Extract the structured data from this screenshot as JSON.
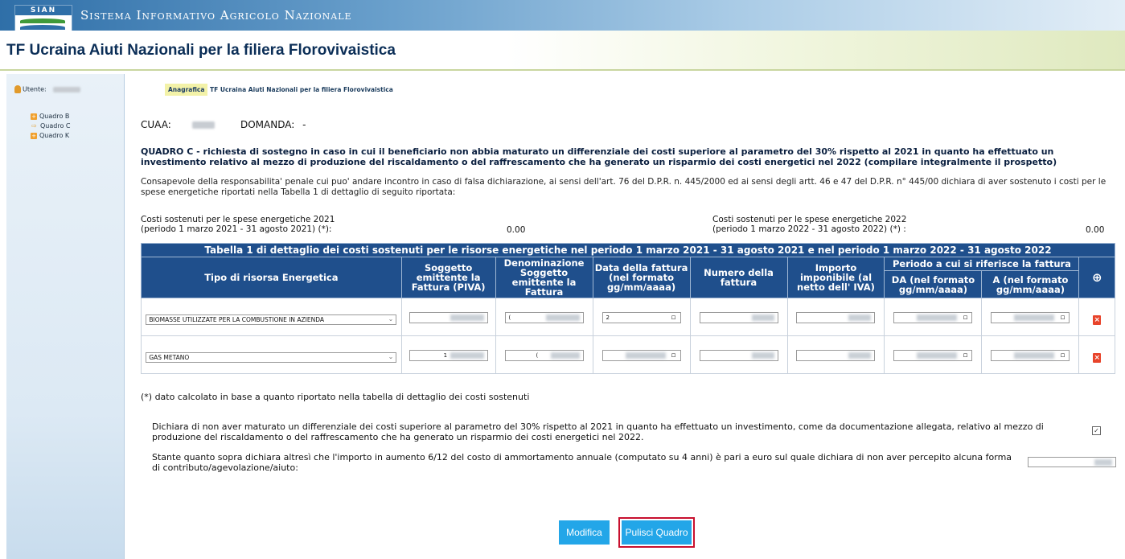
{
  "header": {
    "logo_text": "SIAN",
    "system_title": "Sistema Informativo Agricolo Nazionale",
    "app_title": "TF Ucraina Aiuti Nazionali per la filiera Florovivaistica"
  },
  "sidebar": {
    "user_label": "Utente:",
    "items": [
      {
        "label": "Quadro B",
        "icon": "orange-plus-icon"
      },
      {
        "label": "Quadro C",
        "icon": "arrow-icon"
      },
      {
        "label": "Quadro K",
        "icon": "orange-plus-icon"
      }
    ]
  },
  "breadcrumb": {
    "first": "Anagrafica",
    "second": "TF Ucraina Aiuti Nazionali per la filiera Florovivaistica"
  },
  "cuaa_label": "CUAA:",
  "domanda_label": "DOMANDA:",
  "domanda_value": "-",
  "quadro": {
    "title_bold": "QUADRO C",
    "title_rest": " - richiesta di sostegno in caso in cui il beneficiario non abbia maturato un differenziale dei costi superiore al parametro del 30% rispetto al 2021 in quanto ha effettuato un investimento relativo al mezzo di produzione del riscaldamento o del raffrescamento che ha generato un risparmio dei costi energetici nel 2022 (compilare integralmente il prospetto)",
    "consapevole": "Consapevole della responsabilita' penale cui puo' andare incontro in caso di falsa dichiarazione, ai sensi dell'art. 76 del D.P.R. n. 445/2000 ed ai sensi degli artt. 46 e 47 del D.P.R. n° 445/00 dichiara di aver sostenuto i costi per le spese energetiche riportati nella Tabella 1 di dettaglio di seguito riportata:"
  },
  "costi": {
    "left_line1": "Costi sostenuti per le spese energetiche 2021",
    "left_line2": "(periodo 1 marzo 2021 - 31 agosto 2021) (*):",
    "left_value": "0.00",
    "right_line1": "Costi sostenuti per le spese energetiche 2022",
    "right_line2": "(periodo 1 marzo 2022 - 31 agosto 2022) (*) :",
    "right_value": "0.00"
  },
  "table": {
    "caption": "Tabella 1 di dettaglio dei costi sostenuti per le risorse energetiche nel periodo 1 marzo 2021 - 31 agosto 2021 e nel periodo 1 marzo 2022 - 31 agosto 2022",
    "headers": {
      "tipo": "Tipo di risorsa Energetica",
      "soggetto": "Soggetto emittente la Fattura (PIVA)",
      "denominazione": "Denominazione Soggetto emittente la Fattura",
      "data": "Data della fattura (nel formato gg/mm/aaaa)",
      "numero": "Numero della fattura",
      "importo": "Importo imponibile (al netto dell' IVA)",
      "periodo": "Periodo a cui si riferisce la fattura",
      "da": "DA (nel formato gg/mm/aaaa)",
      "a": "A (nel formato gg/mm/aaaa)",
      "add_icon": "⊕"
    },
    "rows": [
      {
        "tipo": "BIOMASSE UTILIZZATE PER LA COMBUSTIONE IN AZIENDA",
        "piva_prefix": "",
        "denom_prefix": "(",
        "data_prefix": "2",
        "a_prefix": ""
      },
      {
        "tipo": "GAS METANO",
        "piva_prefix": "1",
        "denom_prefix": "(",
        "data_prefix": "",
        "a_prefix": ""
      }
    ]
  },
  "note": "(*) dato calcolato in base a quanto riportato nella tabella di dettaglio dei costi sostenuti",
  "dichiara1": "Dichiara di non aver maturato un differenziale dei costi superiore al parametro del 30% rispetto al 2021 in quanto ha effettuato un investimento, come da documentazione allegata, relativo al mezzo di produzione del riscaldamento o del raffrescamento che ha generato un risparmio dei costi energetici nel 2022.",
  "dichiara2": "Stante quanto sopra dichiara altresì che l'importo in aumento 6/12 del costo di ammortamento annuale (computato su 4 anni) è pari a euro sul quale dichiara di non aver percepito alcuna forma di contributo/agevolazione/aiuto:",
  "buttons": {
    "modifica": "Modifica",
    "pulisci": "Pulisci Quadro"
  }
}
